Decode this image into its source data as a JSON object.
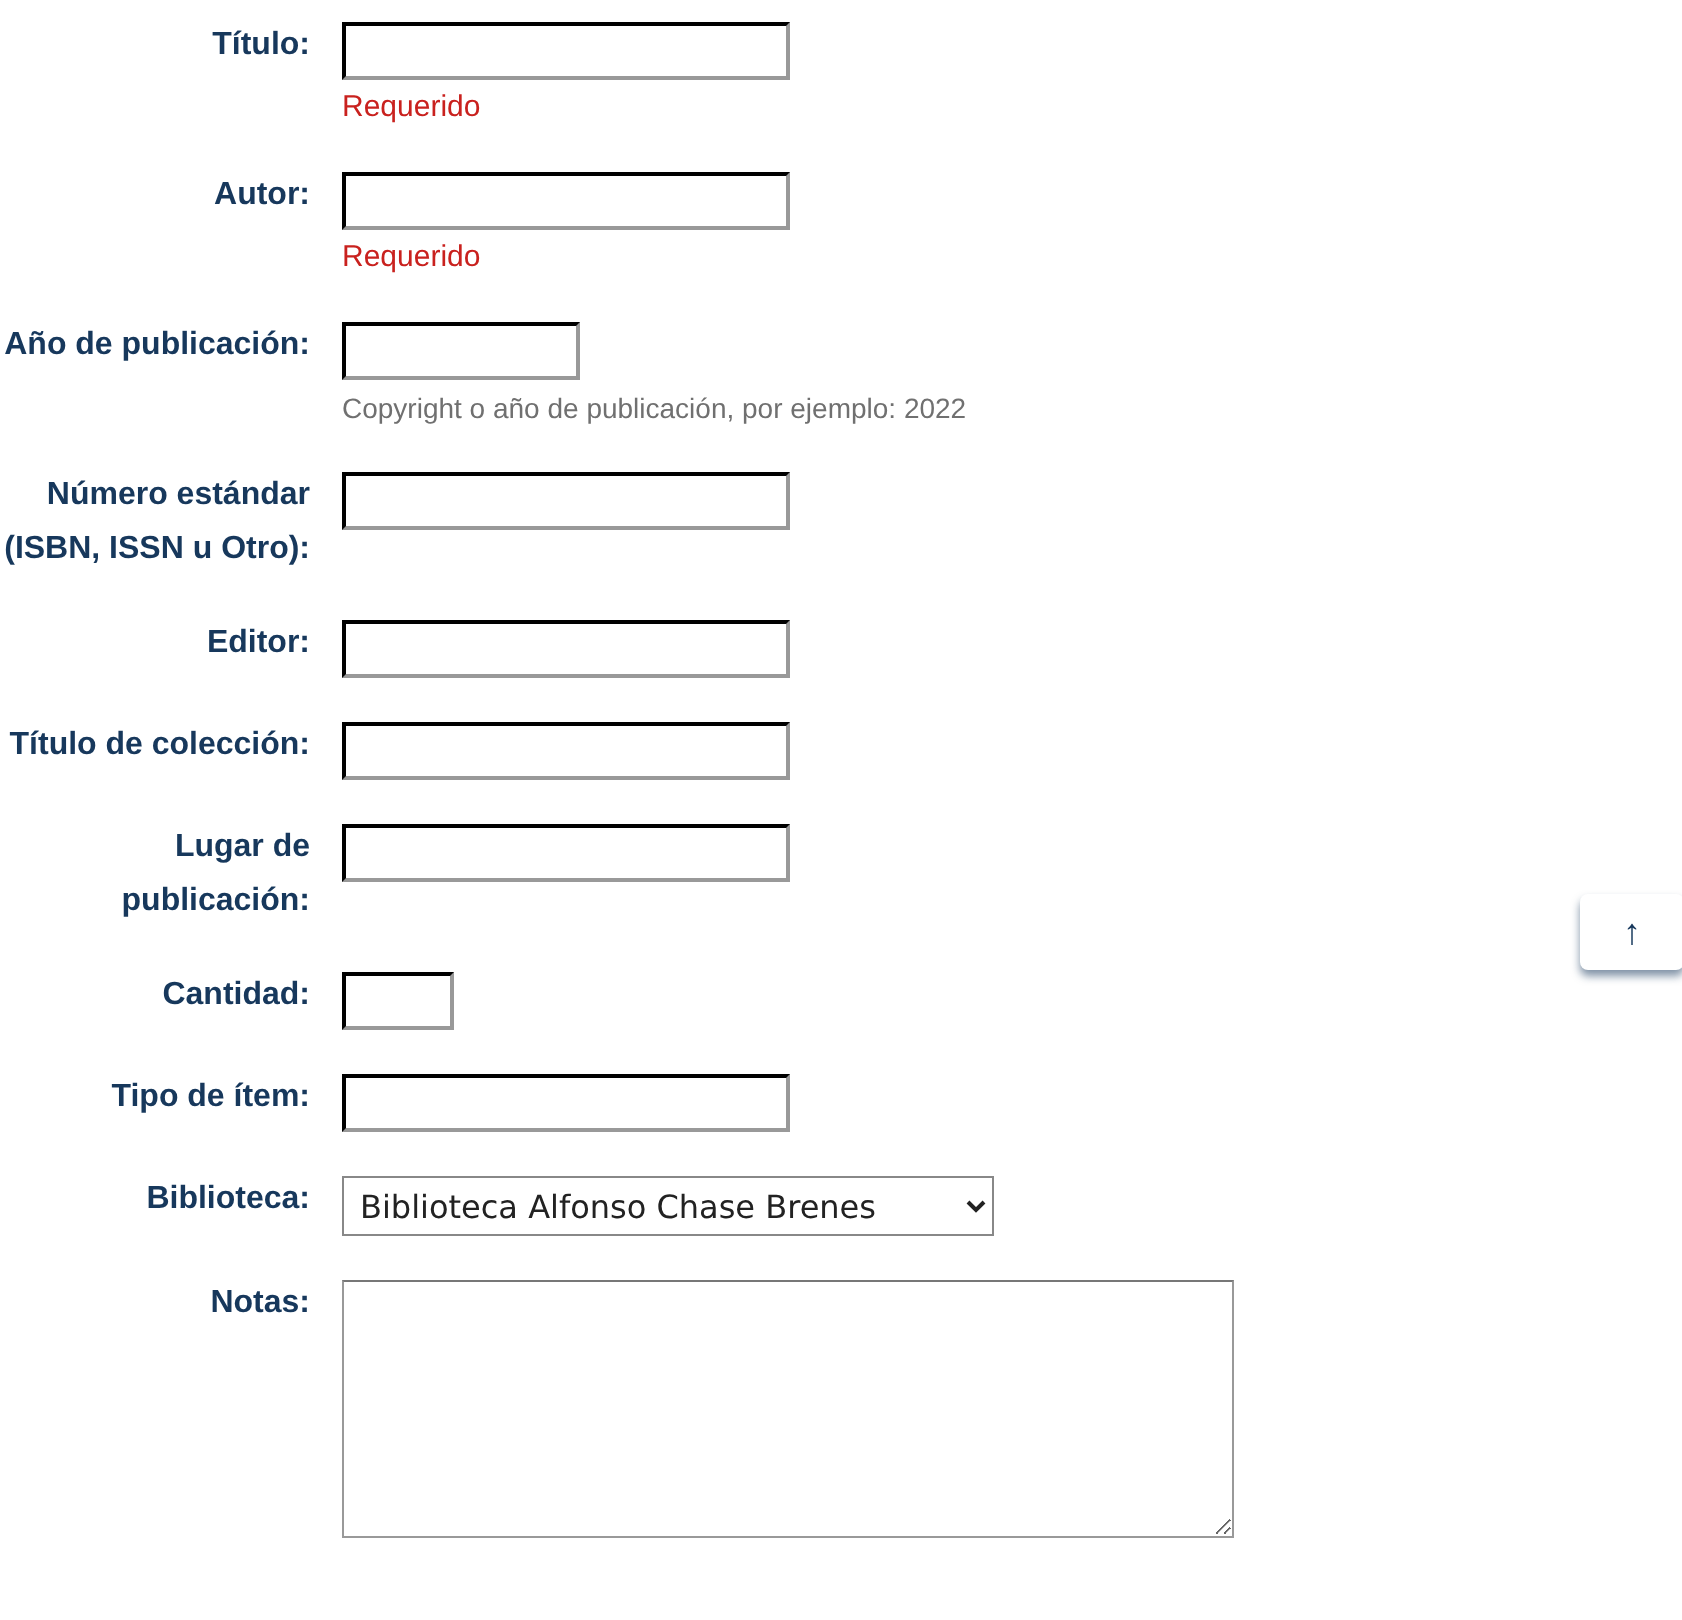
{
  "fields": [
    {
      "kind": "text",
      "label": "Título:",
      "required_note": "Requerido"
    },
    {
      "kind": "text",
      "label": "Autor:",
      "required_note": "Requerido"
    },
    {
      "kind": "year",
      "label": "Año de publicación:",
      "hint": "Copyright o año de publicación, por ejemplo: 2022"
    },
    {
      "kind": "text",
      "label": "Número estándar (ISBN, ISSN u Otro):"
    },
    {
      "kind": "text",
      "label": "Editor:"
    },
    {
      "kind": "text",
      "label": "Título de colección:"
    },
    {
      "kind": "text",
      "label": "Lugar de publicación:"
    },
    {
      "kind": "quantity",
      "label": "Cantidad:"
    },
    {
      "kind": "text",
      "label": "Tipo de ítem:"
    },
    {
      "kind": "select",
      "label": "Biblioteca:",
      "value": "Biblioteca Alfonso Chase Brenes"
    },
    {
      "kind": "textarea",
      "label": "Notas:"
    }
  ],
  "back_to_top": {
    "icon": "↑"
  }
}
